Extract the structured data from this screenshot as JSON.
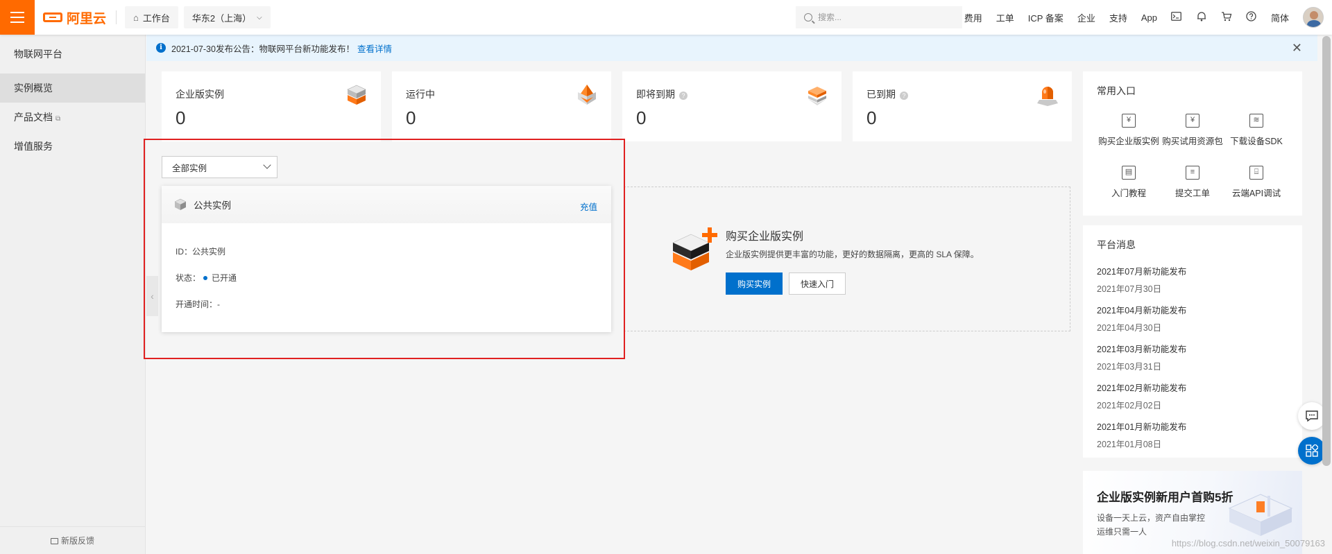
{
  "topbar": {
    "brand": "阿里云",
    "workbench": "工作台",
    "region": "华东2（上海）",
    "search_placeholder": "搜索...",
    "nav": [
      "费用",
      "工单",
      "ICP 备案",
      "企业",
      "支持",
      "App"
    ],
    "lang": "简体",
    "icons": [
      "terminal-icon",
      "bell-icon",
      "cart-icon",
      "help-icon"
    ]
  },
  "sidebar": {
    "title": "物联网平台",
    "items": [
      {
        "label": "实例概览",
        "active": true
      },
      {
        "label": "产品文档",
        "external": true
      },
      {
        "label": "增值服务"
      }
    ],
    "feedback": "新版反馈"
  },
  "announcement": {
    "text": "2021-07-30发布公告：物联网平台新功能发布！",
    "link": "查看详情"
  },
  "stats": [
    {
      "label": "企业版实例",
      "value": "0",
      "help": false
    },
    {
      "label": "运行中",
      "value": "0",
      "help": false
    },
    {
      "label": "即将到期",
      "value": "0",
      "help": true
    },
    {
      "label": "已到期",
      "value": "0",
      "help": true
    }
  ],
  "filter": {
    "selected": "全部实例"
  },
  "instance": {
    "name": "公共实例",
    "action": "充值",
    "id_label": "ID：",
    "id_value": "公共实例",
    "status_label": "状态：",
    "status_value": "已开通",
    "opened_label": "开通时间：",
    "opened_value": "-"
  },
  "buy": {
    "title": "购买企业版实例",
    "desc": "企业版实例提供更丰富的功能，更好的数据隔离，更高的 SLA 保障。",
    "primary": "购买实例",
    "secondary": "快速入门"
  },
  "quick": {
    "title": "常用入口",
    "items": [
      {
        "label": "购买企业版实例",
        "icon": "purchase-icon"
      },
      {
        "label": "购买试用资源包",
        "icon": "yuan-icon"
      },
      {
        "label": "下载设备SDK",
        "icon": "layers-icon"
      },
      {
        "label": "入门教程",
        "icon": "tutorial-icon"
      },
      {
        "label": "提交工单",
        "icon": "ticket-icon"
      },
      {
        "label": "云端API调试",
        "icon": "api-icon"
      }
    ]
  },
  "messages": {
    "title": "平台消息",
    "items": [
      {
        "title": "2021年07月新功能发布",
        "date": "2021年07月30日"
      },
      {
        "title": "2021年04月新功能发布",
        "date": "2021年04月30日"
      },
      {
        "title": "2021年03月新功能发布",
        "date": "2021年03月31日"
      },
      {
        "title": "2021年02月新功能发布",
        "date": "2021年02月02日"
      },
      {
        "title": "2021年01月新功能发布",
        "date": "2021年01月08日"
      }
    ]
  },
  "promo": {
    "title": "企业版实例新用户首购5折",
    "line1": "设备一天上云，资产自由掌控",
    "line2": "运维只需一人"
  },
  "watermark": "https://blog.csdn.net/weixin_50079163",
  "colors": {
    "brand": "#ff6a00",
    "primary": "#0070cc",
    "highlight": "#e02020"
  }
}
